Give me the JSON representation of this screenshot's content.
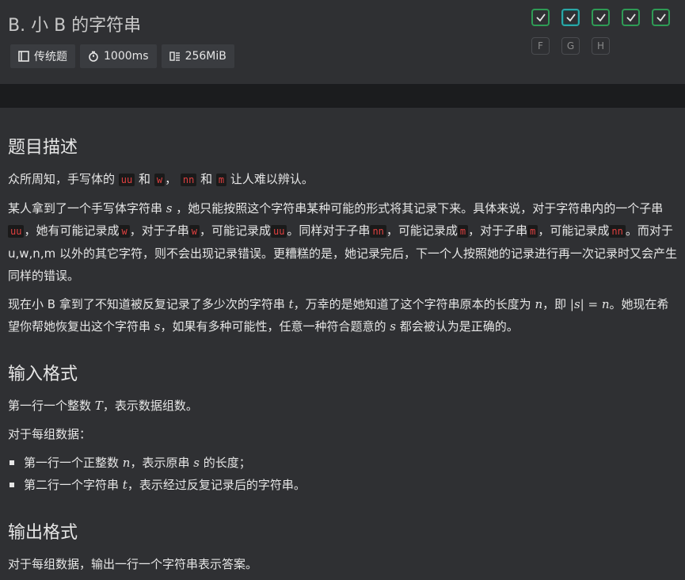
{
  "header": {
    "title": "B. 小 B 的字符串",
    "meta": [
      {
        "icon": "book-icon",
        "label": "传统题"
      },
      {
        "icon": "timer-icon",
        "label": "1000ms"
      },
      {
        "icon": "memory-icon",
        "label": "256MiB"
      }
    ],
    "status_row1": [
      "ok",
      "ok",
      "ok",
      "ok",
      "ok"
    ],
    "status_row2": [
      "F",
      "G",
      "H"
    ]
  },
  "content": {
    "sec_desc": "题目描述",
    "p1": {
      "a": "众所周知，手写体的",
      "c1": "uu",
      "b": "和",
      "c2": "w",
      "c": "，",
      "c3": "nn",
      "d": "和",
      "c4": "m",
      "e": "让人难以辨认。"
    },
    "p2": {
      "a": "某人拿到了一个手写体字符串",
      "s": "s",
      "b": "，她只能按照这个字符串某种可能的形式将其记录下来。具体来说，对于字符串内的一个子串",
      "c1": "uu",
      "c": "，她有可能记录成",
      "c2": "w",
      "d": "，对于子串",
      "c3": "w",
      "e": "，可能记录成",
      "c4": "uu",
      "f": "。同样对于子串",
      "c5": "nn",
      "g": "，可能记录成",
      "c6": "m",
      "h": "，对于子串",
      "c7": "m",
      "i": "，可能记录成",
      "c8": "nn",
      "j": "。而对于 u,w,n,m 以外的其它字符，则不会出现记录错误。更糟糕的是，她记录完后，下一个人按照她的记录进行再一次记录时又会产生同样的错误。"
    },
    "p3": {
      "a": "现在小 B 拿到了不知道被反复记录了多少次的字符串",
      "t": "t",
      "b": "，万幸的是她知道了这个字符串原本的长度为",
      "n": "n",
      "c": "，即",
      "eq": "|s| = n",
      "d": "。她现在希望你帮她恢复出这个字符串",
      "s": "s",
      "e": "，如果有多种可能性，任意一种符合题意的",
      "s2": "s",
      "f": "都会被认为是正确的。"
    },
    "sec_input": "输入格式",
    "in1": {
      "a": "第一行一个整数",
      "T": "T",
      "b": "，表示数据组数。"
    },
    "in2": "对于每组数据：",
    "li1": {
      "a": "第一行一个正整数",
      "n": "n",
      "b": "，表示原串",
      "s": "s",
      "c": "的长度；"
    },
    "li2": {
      "a": "第二行一个字符串",
      "t": "t",
      "b": "，表示经过反复记录后的字符串。"
    },
    "sec_output": "输出格式",
    "out1": "对于每组数据，输出一行一个字符串表示答案。"
  }
}
